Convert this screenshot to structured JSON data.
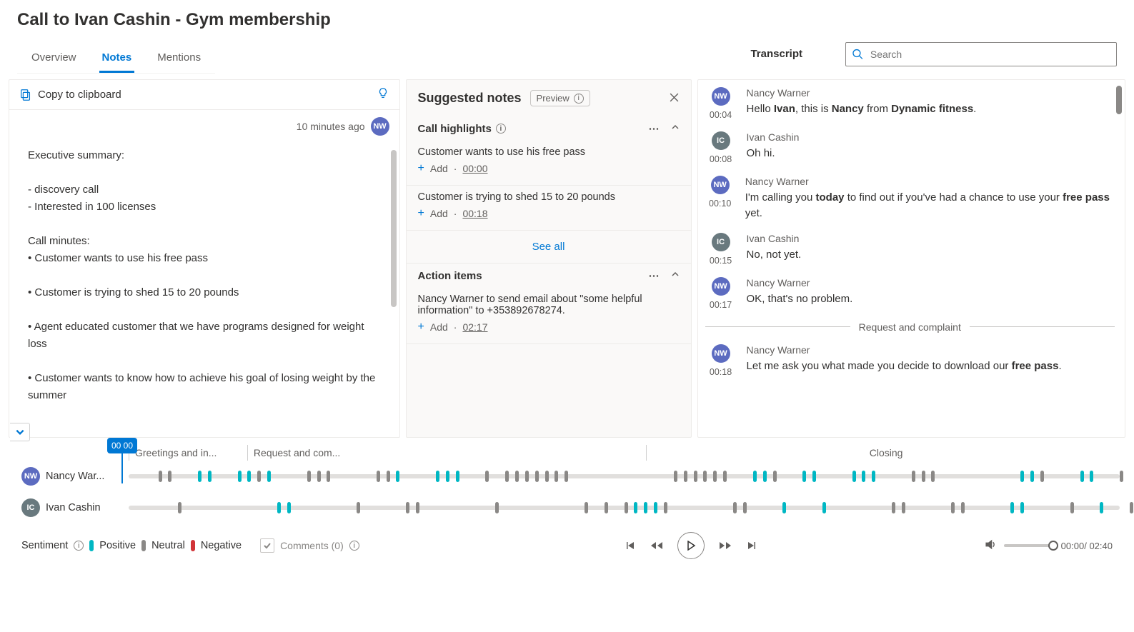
{
  "page_title": "Call to Ivan Cashin - Gym membership",
  "tabs": [
    "Overview",
    "Notes",
    "Mentions"
  ],
  "active_tab": 1,
  "transcript_label": "Transcript",
  "search_placeholder": "Search",
  "copy_label": "Copy to clipboard",
  "notes_meta": {
    "ago": "10 minutes ago",
    "initials": "NW"
  },
  "notes_body_lines": [
    "Executive summary:",
    "",
    "- discovery call",
    "- Interested in 100 licenses",
    "",
    "Call minutes:",
    "• Customer wants to use his free pass",
    "",
    "• Customer is trying to shed 15 to 20 pounds",
    "",
    "• Agent educated customer that we have programs designed for weight loss",
    "",
    "• Customer wants to know how to achieve his goal of losing weight by the summer"
  ],
  "suggest": {
    "title": "Suggested notes",
    "preview": "Preview",
    "highlights_title": "Call highlights",
    "action_title": "Action items",
    "see_all": "See all",
    "add_label": "Add",
    "highlights": [
      {
        "text": "Customer wants to use his free pass",
        "ts": "00:00"
      },
      {
        "text": "Customer is trying to shed 15 to 20 pounds",
        "ts": "00:18"
      }
    ],
    "actions": [
      {
        "text": "Nancy Warner to send email about \"some helpful information\" to +353892678274.",
        "ts": "02:17"
      }
    ]
  },
  "transcript": [
    {
      "who": "Nancy Warner",
      "initials": "NW",
      "cls": "nw",
      "time": "00:04",
      "html": "Hello <b>Ivan</b>, this is <b>Nancy</b> from <b>Dynamic fitness</b>."
    },
    {
      "who": "Ivan Cashin",
      "initials": "IC",
      "cls": "ic",
      "time": "00:08",
      "html": "Oh hi."
    },
    {
      "who": "Nancy Warner",
      "initials": "NW",
      "cls": "nw",
      "time": "00:10",
      "html": "I'm calling you <b>today</b> to find out if you've had a chance to use your <b>free pass</b> yet."
    },
    {
      "who": "Ivan Cashin",
      "initials": "IC",
      "cls": "ic",
      "time": "00:15",
      "html": "No, not yet."
    },
    {
      "who": "Nancy Warner",
      "initials": "NW",
      "cls": "nw",
      "time": "00:17",
      "html": "OK, that's no problem."
    }
  ],
  "transcript_divider": "Request and complaint",
  "transcript_after": [
    {
      "who": "Nancy Warner",
      "initials": "NW",
      "cls": "nw",
      "time": "00:18",
      "html": "Let me ask you what made you decide to download our <b>free pass</b>."
    }
  ],
  "timeline": {
    "marker": "00:00",
    "segments": [
      {
        "label": "Greetings and in...",
        "flex": 0.12
      },
      {
        "label": "Request and com...",
        "flex": 0.42
      },
      {
        "label": "Closing",
        "flex": 0.5
      }
    ],
    "tracks": [
      {
        "name": "Nancy War...",
        "initials": "NW",
        "cls": "nw",
        "ticks": [
          {
            "p": 3,
            "t": "n"
          },
          {
            "p": 4,
            "t": "n"
          },
          {
            "p": 7,
            "t": "p"
          },
          {
            "p": 8,
            "t": "p"
          },
          {
            "p": 11,
            "t": "p"
          },
          {
            "p": 12,
            "t": "p"
          },
          {
            "p": 13,
            "t": "n"
          },
          {
            "p": 14,
            "t": "p"
          },
          {
            "p": 18,
            "t": "n"
          },
          {
            "p": 19,
            "t": "n"
          },
          {
            "p": 20,
            "t": "n"
          },
          {
            "p": 25,
            "t": "n"
          },
          {
            "p": 26,
            "t": "n"
          },
          {
            "p": 27,
            "t": "p"
          },
          {
            "p": 31,
            "t": "p"
          },
          {
            "p": 32,
            "t": "p"
          },
          {
            "p": 33,
            "t": "p"
          },
          {
            "p": 36,
            "t": "n"
          },
          {
            "p": 38,
            "t": "n"
          },
          {
            "p": 39,
            "t": "n"
          },
          {
            "p": 40,
            "t": "n"
          },
          {
            "p": 41,
            "t": "n"
          },
          {
            "p": 42,
            "t": "n"
          },
          {
            "p": 43,
            "t": "n"
          },
          {
            "p": 44,
            "t": "n"
          },
          {
            "p": 55,
            "t": "n"
          },
          {
            "p": 56,
            "t": "n"
          },
          {
            "p": 57,
            "t": "n"
          },
          {
            "p": 58,
            "t": "n"
          },
          {
            "p": 59,
            "t": "n"
          },
          {
            "p": 60,
            "t": "n"
          },
          {
            "p": 63,
            "t": "p"
          },
          {
            "p": 64,
            "t": "p"
          },
          {
            "p": 65,
            "t": "n"
          },
          {
            "p": 68,
            "t": "p"
          },
          {
            "p": 69,
            "t": "p"
          },
          {
            "p": 73,
            "t": "p"
          },
          {
            "p": 74,
            "t": "p"
          },
          {
            "p": 75,
            "t": "p"
          },
          {
            "p": 79,
            "t": "n"
          },
          {
            "p": 80,
            "t": "n"
          },
          {
            "p": 81,
            "t": "n"
          },
          {
            "p": 90,
            "t": "p"
          },
          {
            "p": 91,
            "t": "p"
          },
          {
            "p": 92,
            "t": "n"
          },
          {
            "p": 96,
            "t": "p"
          },
          {
            "p": 97,
            "t": "p"
          },
          {
            "p": 100,
            "t": "n"
          }
        ]
      },
      {
        "name": "Ivan Cashin",
        "initials": "IC",
        "cls": "ic",
        "ticks": [
          {
            "p": 5,
            "t": "n"
          },
          {
            "p": 15,
            "t": "p"
          },
          {
            "p": 16,
            "t": "p"
          },
          {
            "p": 23,
            "t": "n"
          },
          {
            "p": 28,
            "t": "n"
          },
          {
            "p": 29,
            "t": "n"
          },
          {
            "p": 37,
            "t": "n"
          },
          {
            "p": 46,
            "t": "n"
          },
          {
            "p": 48,
            "t": "n"
          },
          {
            "p": 50,
            "t": "n"
          },
          {
            "p": 51,
            "t": "p"
          },
          {
            "p": 52,
            "t": "p"
          },
          {
            "p": 53,
            "t": "p"
          },
          {
            "p": 54,
            "t": "n"
          },
          {
            "p": 61,
            "t": "n"
          },
          {
            "p": 62,
            "t": "n"
          },
          {
            "p": 66,
            "t": "p"
          },
          {
            "p": 70,
            "t": "p"
          },
          {
            "p": 77,
            "t": "n"
          },
          {
            "p": 78,
            "t": "n"
          },
          {
            "p": 83,
            "t": "n"
          },
          {
            "p": 84,
            "t": "n"
          },
          {
            "p": 89,
            "t": "p"
          },
          {
            "p": 90,
            "t": "p"
          },
          {
            "p": 95,
            "t": "n"
          },
          {
            "p": 98,
            "t": "p"
          },
          {
            "p": 101,
            "t": "n"
          }
        ]
      }
    ]
  },
  "sentiment": {
    "label": "Sentiment",
    "pos": "Positive",
    "neu": "Neutral",
    "neg": "Negative"
  },
  "comments": "Comments (0)",
  "playback": {
    "current": "00:00",
    "total": "02:40"
  }
}
